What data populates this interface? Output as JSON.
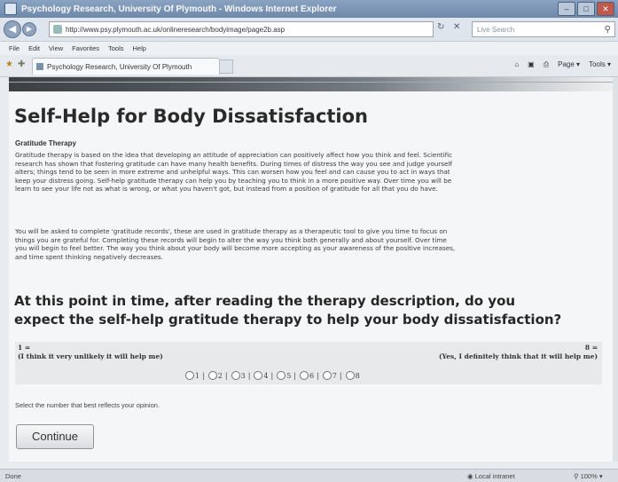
{
  "window": {
    "title": "Psychology Research, University Of Plymouth - Windows Internet Explorer"
  },
  "address_bar": {
    "url": "http://www.psy.plymouth.ac.uk/onlineresearch/bodyimage/page2b.asp",
    "search_placeholder": "Live Search"
  },
  "menu": [
    "File",
    "Edit",
    "View",
    "Favorites",
    "Tools",
    "Help"
  ],
  "tab": {
    "label": "Psychology Research, University Of Plymouth"
  },
  "command_bar": {
    "page_label": "Page",
    "tools_label": "Tools"
  },
  "page": {
    "title": "Self-Help for Body Dissatisfaction",
    "subheading": "Gratitude Therapy",
    "paragraphs": [
      {
        "lines": [
          "Gratitude therapy is based on the idea that developing an attitude of appreciation can positively affect how you think and feel. Scientific",
          "research has shown that fostering gratitude can have many health benefits. During times of distress the way you see and judge yourself",
          "alters; things tend to be seen in more extreme and unhelpful ways. This can worsen how you feel and can cause you to act in ways that",
          "keep your distress going. Self-help gratitude therapy can help you by teaching you to think in a more positive way. Over time you will be",
          "learn to see your life not as what is wrong, or what you haven't got, but instead from a position of gratitude for all that you do have."
        ]
      },
      {
        "lines": [
          "You will be asked to complete 'gratitude records', these are used in gratitude therapy as a therapeutic tool to give you time to focus on",
          "things you are grateful for. Completing these records will begin to alter the way you think both generally and about yourself. Over time",
          "you will begin to feel better. The way you think about your body will become more accepting as your awareness of the positive increases,",
          "and time spent thinking negatively decreases."
        ]
      }
    ],
    "question_lines": [
      "At this point in time, after reading the therapy description, do you",
      "expect the self-help gratitude therapy to help your body dissatisfaction?"
    ],
    "scale": {
      "left_num": "1 =",
      "left_text": "(I think it very unlikely it will help me)",
      "right_num": "8 =",
      "right_text": "(Yes, I definitely think that it will help me)",
      "options": [
        "1",
        "2",
        "3",
        "4",
        "5",
        "6",
        "7",
        "8"
      ],
      "selected": null
    },
    "instruction": "Select the number that best reflects your opinion.",
    "continue_label": "Continue"
  },
  "status_bar": {
    "status": "Done",
    "zone": "Local intranet",
    "zoom": "100%"
  }
}
